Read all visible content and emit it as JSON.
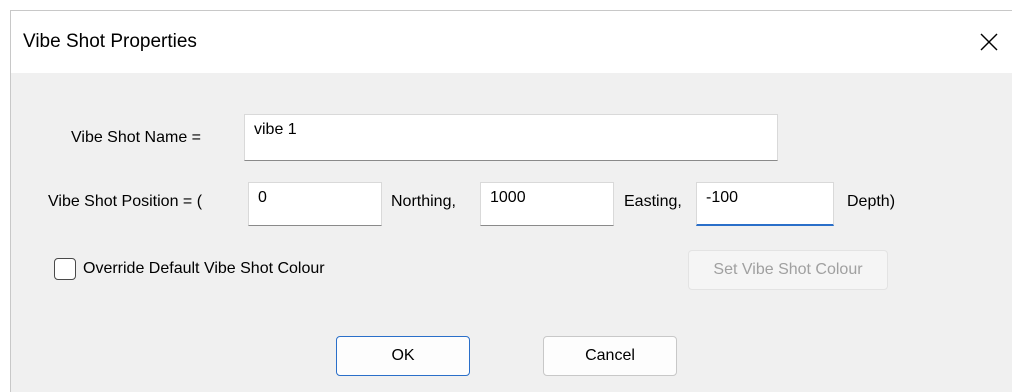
{
  "window": {
    "title": "Vibe Shot Properties",
    "close_icon": "close-icon"
  },
  "name_row": {
    "label": "Vibe Shot Name =",
    "value": "vibe 1"
  },
  "position_row": {
    "label": "Vibe Shot Position = (",
    "northing_value": "0",
    "northing_label": "Northing,",
    "easting_value": "1000",
    "easting_label": "Easting,",
    "depth_value": "-100",
    "depth_label": "Depth)"
  },
  "colour_row": {
    "checkbox_label": "Override Default Vibe Shot Colour",
    "checkbox_checked": false,
    "set_colour_label": "Set Vibe Shot Colour"
  },
  "buttons": {
    "ok_label": "OK",
    "cancel_label": "Cancel"
  },
  "colors": {
    "focus_accent": "#2a6fc9",
    "dialog_background": "#f0f0f0"
  }
}
